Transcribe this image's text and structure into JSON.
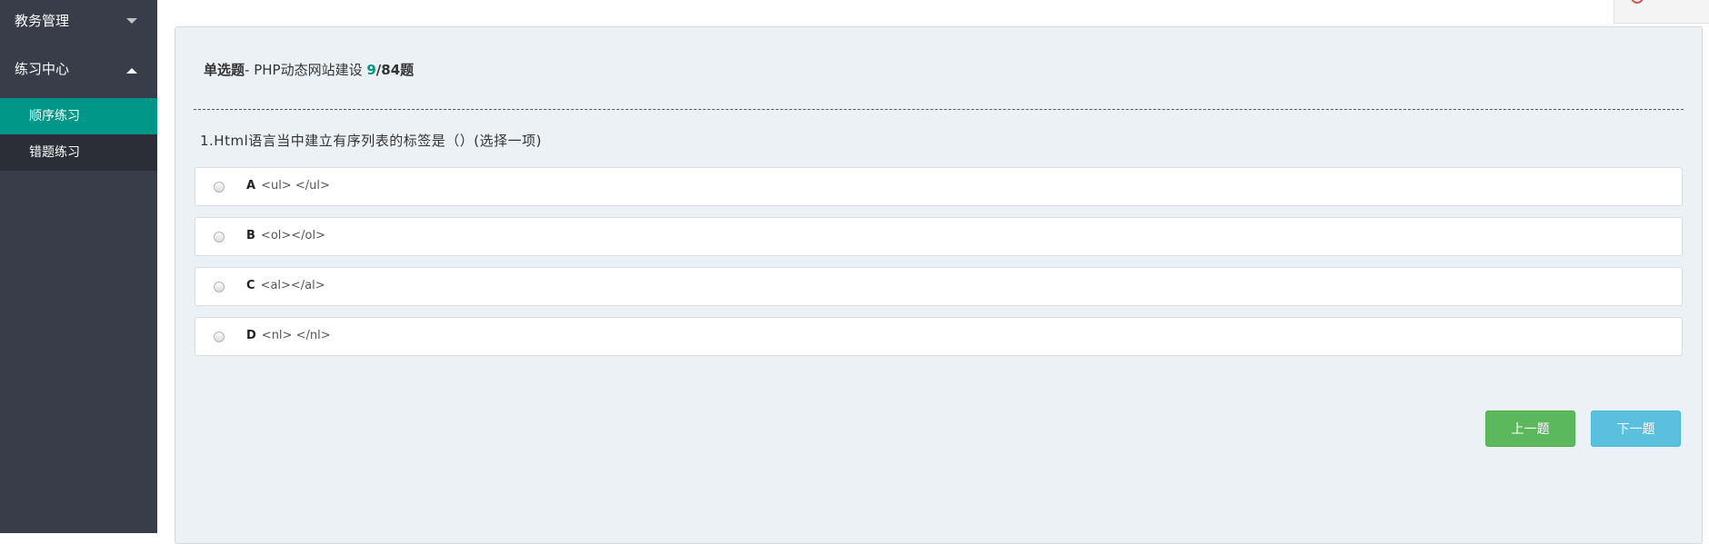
{
  "sidebar": {
    "groups": [
      {
        "label": "教务管理",
        "expanded": false
      },
      {
        "label": "练习中心",
        "expanded": true,
        "items": [
          {
            "label": "顺序练习",
            "active": true
          },
          {
            "label": "错题练习",
            "active": false
          }
        ]
      }
    ]
  },
  "quiz": {
    "type_label": "单选题",
    "separator": "- ",
    "course": "PHP动态网站建设",
    "current": "9",
    "slash_total": "/84题",
    "question": "1.Html语言当中建立有序列表的标签是（）(选择一项)",
    "options": [
      {
        "letter": "A",
        "text": "<ul> </ul>"
      },
      {
        "letter": "B",
        "text": "<ol></ol>"
      },
      {
        "letter": "C",
        "text": "<al></al>"
      },
      {
        "letter": "D",
        "text": "<nl> </nl>"
      }
    ],
    "prev_label": "上一题",
    "next_label": "下一题"
  },
  "colors": {
    "sidebar_bg": "#393d49",
    "active_item": "#009688",
    "prev_button": "#5cb85c",
    "next_button": "#5bc0de"
  }
}
